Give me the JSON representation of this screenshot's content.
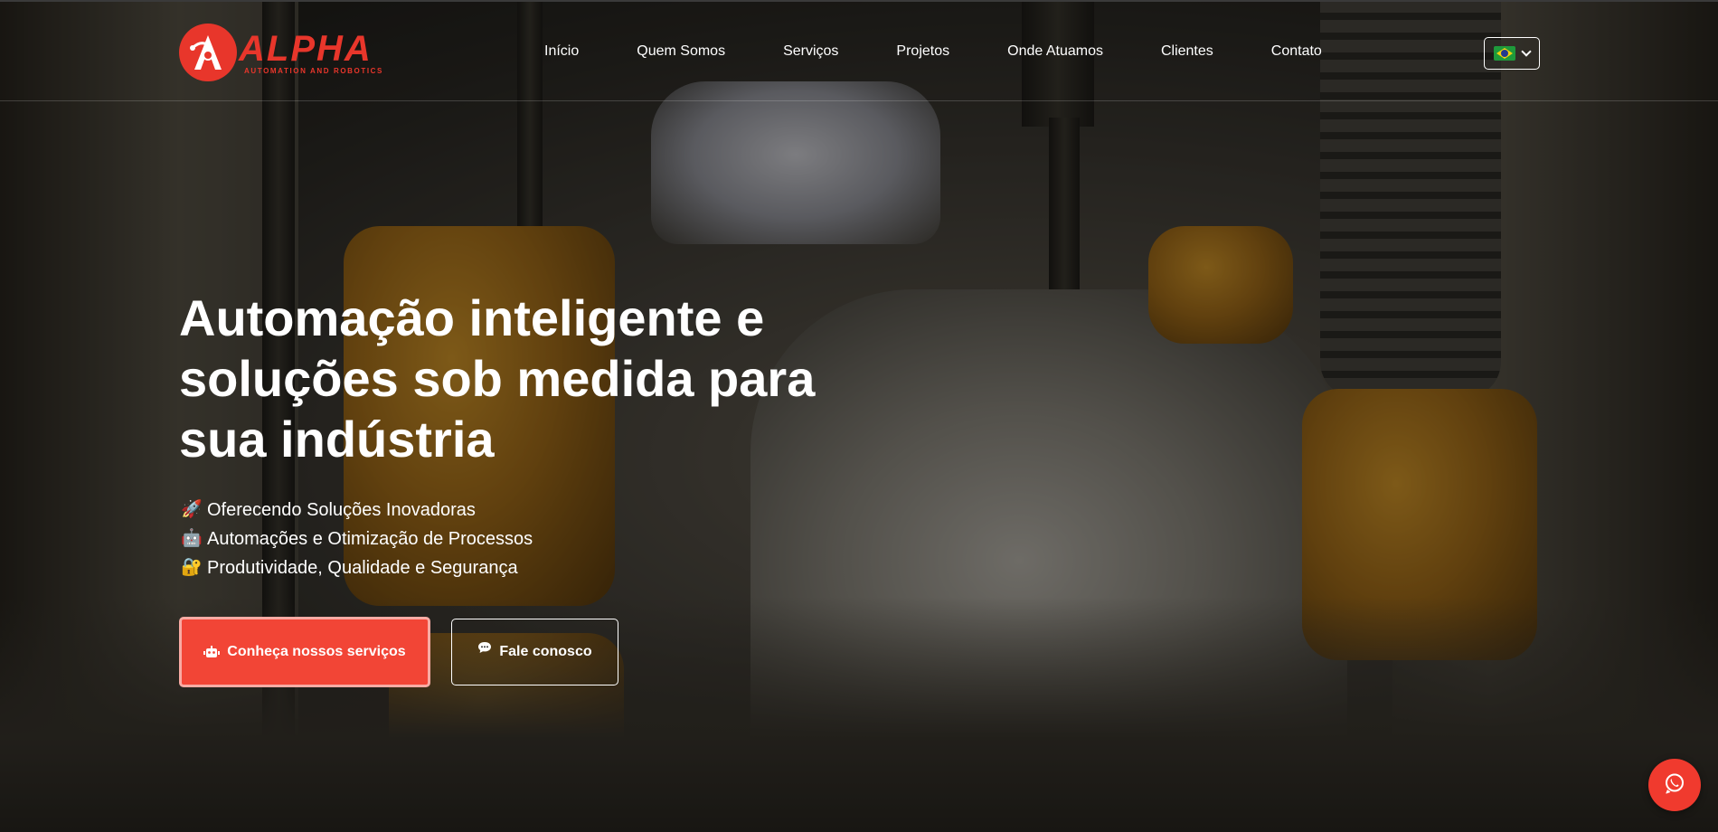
{
  "brand": {
    "name": "ALPHA",
    "tagline": "AUTOMATION AND ROBOTICS",
    "color": "#e8362b"
  },
  "nav": {
    "items": [
      {
        "label": "Início"
      },
      {
        "label": "Quem Somos"
      },
      {
        "label": "Serviços"
      },
      {
        "label": "Projetos"
      },
      {
        "label": "Onde Atuamos"
      },
      {
        "label": "Clientes"
      },
      {
        "label": "Contato"
      }
    ]
  },
  "language": {
    "selected_flag": "brazil-flag-icon"
  },
  "hero": {
    "title": "Automação inteligente e soluções sob medida para sua indústria",
    "features": [
      {
        "icon": "rocket-icon",
        "emoji": "🚀",
        "text": "Oferecendo Soluções Inovadoras"
      },
      {
        "icon": "robot-icon",
        "emoji": "🤖",
        "text": "Automações e Otimização de Processos"
      },
      {
        "icon": "lock-icon",
        "emoji": "🔐",
        "text": "Produtividade, Qualidade e Segurança"
      }
    ],
    "primary_button": {
      "label": "Conheça nossos serviços",
      "icon": "robot-icon",
      "color": "#f24536"
    },
    "secondary_button": {
      "label": "Fale conosco",
      "icon": "chat-icon"
    }
  },
  "fab": {
    "icon": "whatsapp-icon",
    "color": "#f03a2e"
  }
}
